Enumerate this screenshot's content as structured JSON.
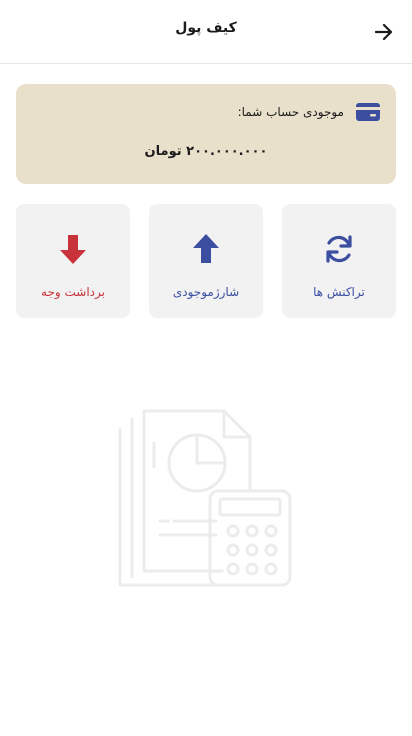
{
  "header": {
    "title": "کیف پول",
    "back_icon": "arrow-right-icon"
  },
  "balance": {
    "label": "موجودی حساب شما:",
    "amount": "۲۰۰.۰۰۰.۰۰۰ تومان",
    "icon": "credit-card-icon",
    "card_color": "#e9e0cc"
  },
  "actions": [
    {
      "label": "تراکنش ها",
      "icon": "refresh-icon",
      "color": "#3b4ea0"
    },
    {
      "label": "شارژموجودی",
      "icon": "arrow-up-icon",
      "color": "#3b4ea0"
    },
    {
      "label": "برداشت وجه",
      "icon": "arrow-down-icon",
      "color": "#c8323b"
    }
  ],
  "empty_state": {
    "icon": "report-calculator-illustration"
  },
  "colors": {
    "accent": "#3b4ea0",
    "danger": "#c8323b",
    "tile_bg": "#f2f2f3"
  }
}
